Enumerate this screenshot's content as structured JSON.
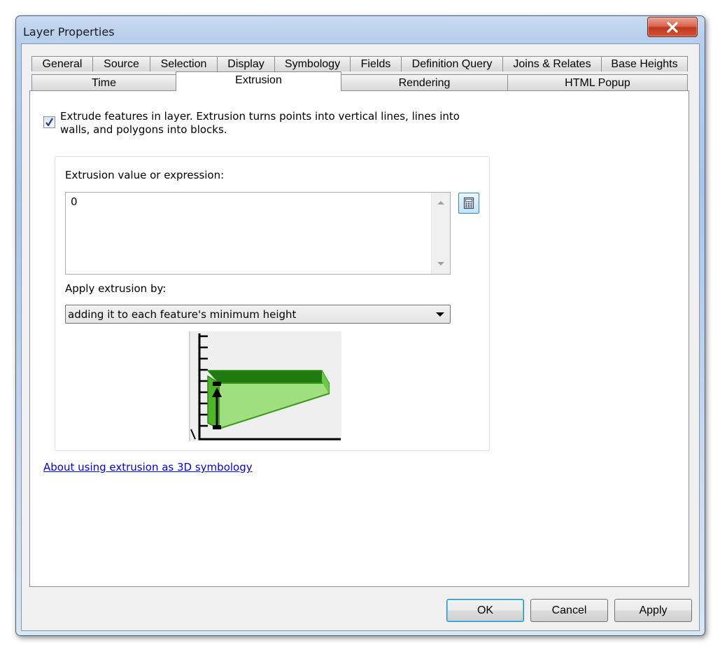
{
  "window": {
    "title": "Layer Properties"
  },
  "tabs_row1": [
    "General",
    "Source",
    "Selection",
    "Display",
    "Symbology",
    "Fields",
    "Definition Query",
    "Joins & Relates",
    "Base Heights"
  ],
  "tabs_row2": [
    "Time",
    "Extrusion",
    "Rendering",
    "HTML Popup"
  ],
  "active_tab": "Extrusion",
  "extrude": {
    "checked": true,
    "checkbox_label": "Extrude features in layer.  Extrusion turns points into vertical lines, lines into walls, and polygons into blocks."
  },
  "expression": {
    "label": "Extrusion value or expression:",
    "value": "0"
  },
  "apply_by": {
    "label": "Apply extrusion by:",
    "selected": "adding it to each feature's minimum height"
  },
  "help_link": "About using extrusion as 3D symbology",
  "buttons": {
    "ok": "OK",
    "cancel": "Cancel",
    "apply": "Apply"
  },
  "colors": {
    "diagram_light_green": "#9fdf7f",
    "diagram_dark_green": "#2a8a0a",
    "link": "#0000ee",
    "close_button": "#c7432a"
  },
  "icons": [
    "close-icon",
    "checkmark-icon",
    "calculator-icon",
    "scroll-up-arrow",
    "scroll-down-arrow",
    "dropdown-arrow"
  ]
}
